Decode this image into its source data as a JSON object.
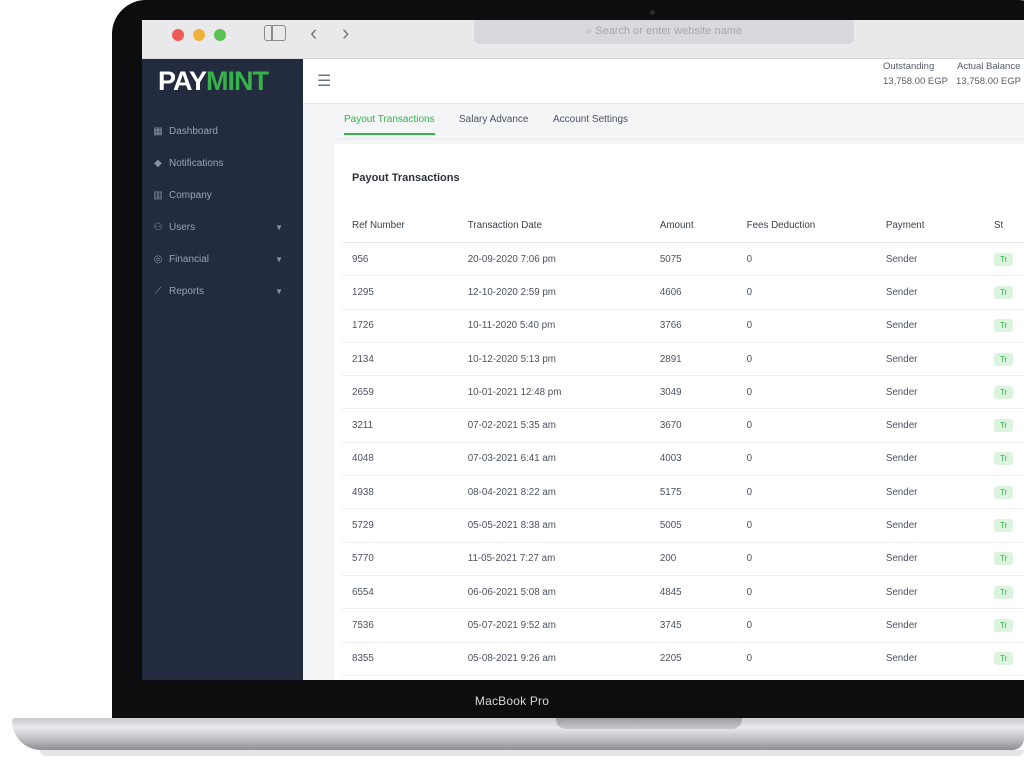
{
  "device": {
    "label": "MacBook Pro"
  },
  "browser": {
    "address_placeholder": "Search or enter website name",
    "back_icon": "chevron-left-icon",
    "forward_icon": "chevron-right-icon"
  },
  "app": {
    "logo_prefix": "PAY",
    "logo_suffix": "MINT",
    "brand_color": "#36b24a",
    "sidebar_bg": "#232c3f",
    "sidebar": {
      "items": [
        {
          "label": "Dashboard",
          "icon": "dashboard-icon",
          "has_chevron": false
        },
        {
          "label": "Notifications",
          "icon": "bell-icon",
          "has_chevron": false
        },
        {
          "label": "Company",
          "icon": "building-icon",
          "has_chevron": false
        },
        {
          "label": "Users",
          "icon": "users-icon",
          "has_chevron": true
        },
        {
          "label": "Financial",
          "icon": "financial-icon",
          "has_chevron": true
        },
        {
          "label": "Reports",
          "icon": "chart-icon",
          "has_chevron": true
        }
      ]
    },
    "header": {
      "outstanding_label": "Outstanding",
      "outstanding_value": "13,758.00 EGP",
      "actual_balance_label": "Actual Balance",
      "actual_balance_value": "13,758.00 EGP"
    },
    "tabs": [
      {
        "label": "Payout Transactions",
        "active": true
      },
      {
        "label": "Salary Advance",
        "active": false
      },
      {
        "label": "Account Settings",
        "active": false
      }
    ],
    "section_title": "Payout Transactions",
    "table": {
      "headers": [
        "Ref Number",
        "Transaction Date",
        "Amount",
        "Fees Deduction",
        "Payment",
        "St"
      ],
      "rows": [
        [
          "956",
          "20-09-2020 7:06 pm",
          "5075",
          "0",
          "Sender",
          "Tr"
        ],
        [
          "1295",
          "12-10-2020 2:59 pm",
          "4606",
          "0",
          "Sender",
          "Tr"
        ],
        [
          "1726",
          "10-11-2020 5:40 pm",
          "3766",
          "0",
          "Sender",
          "Tr"
        ],
        [
          "2134",
          "10-12-2020 5:13 pm",
          "2891",
          "0",
          "Sender",
          "Tr"
        ],
        [
          "2659",
          "10-01-2021 12:48 pm",
          "3049",
          "0",
          "Sender",
          "Tr"
        ],
        [
          "3211",
          "07-02-2021 5:35 am",
          "3670",
          "0",
          "Sender",
          "Tr"
        ],
        [
          "4048",
          "07-03-2021 6:41 am",
          "4003",
          "0",
          "Sender",
          "Tr"
        ],
        [
          "4938",
          "08-04-2021 8:22 am",
          "5175",
          "0",
          "Sender",
          "Tr"
        ],
        [
          "5729",
          "05-05-2021 8:38 am",
          "5005",
          "0",
          "Sender",
          "Tr"
        ],
        [
          "5770",
          "11-05-2021 7:27 am",
          "200",
          "0",
          "Sender",
          "Tr"
        ],
        [
          "6554",
          "06-06-2021 5:08 am",
          "4845",
          "0",
          "Sender",
          "Tr"
        ],
        [
          "7536",
          "05-07-2021 9:52 am",
          "3745",
          "0",
          "Sender",
          "Tr"
        ],
        [
          "8355",
          "05-08-2021 9:26 am",
          "2205",
          "0",
          "Sender",
          "Tr"
        ]
      ]
    }
  }
}
